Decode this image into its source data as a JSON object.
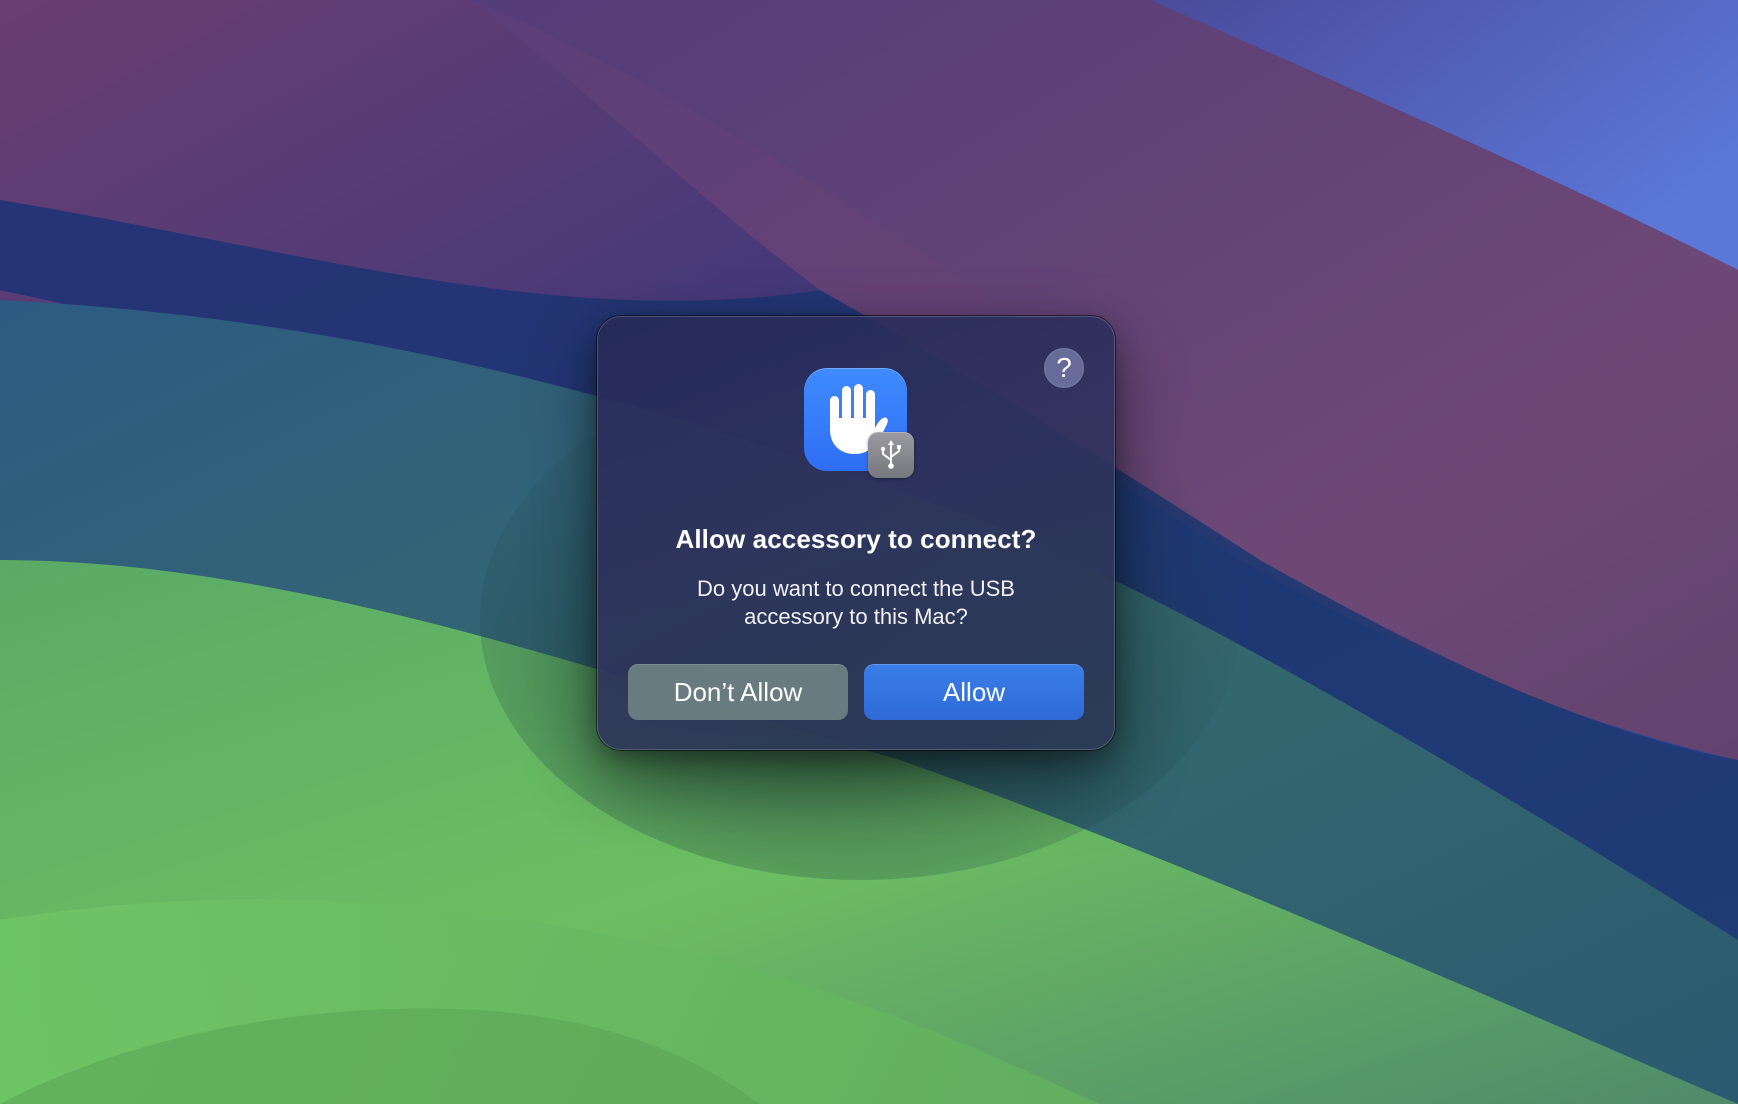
{
  "wallpaper": {
    "name": "macOS Sonoma wallpaper",
    "colors": {
      "deep_blue": "#243070",
      "purple": "#5a3e78",
      "pink": "#7a4a70",
      "periwinkle": "#5a70d0",
      "teal": "#346a6e",
      "green": "#6fc060"
    }
  },
  "dialog": {
    "title": "Allow accessory to connect?",
    "message_line1": "Do you want to connect the USB",
    "message_line2": "accessory to this Mac?",
    "help_label": "?",
    "icon": "privacy-hand-icon",
    "badge_icon": "usb-icon",
    "buttons": {
      "dont_allow": "Don’t Allow",
      "allow": "Allow"
    },
    "colors": {
      "primary_button": "#2f6bd8",
      "icon_blue": "#3a7df7",
      "badge_gray": "#8a8a90"
    }
  }
}
